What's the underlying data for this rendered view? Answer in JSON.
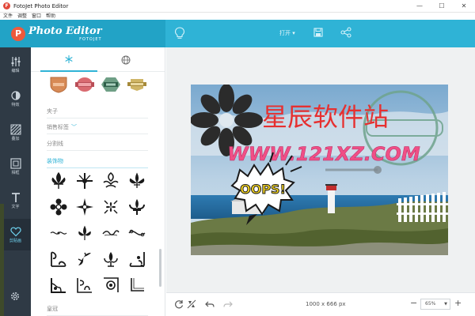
{
  "window": {
    "title": "FotoJet Photo Editor",
    "app_icon_letter": "F",
    "minimize": "—",
    "maximize": "☐",
    "close": "✕"
  },
  "menu": [
    "文件",
    "调整",
    "窗口",
    "帮助"
  ],
  "header": {
    "logo_letter": "P",
    "logo_title": "Photo Editor",
    "logo_sub": "FOTOJET",
    "open_label": "打开 ▾",
    "icons": [
      "bulb-icon",
      "save-icon",
      "share-icon"
    ]
  },
  "rail": {
    "items": [
      {
        "label": "编辑",
        "icon": "sliders-icon"
      },
      {
        "label": "特效",
        "icon": "effects-icon"
      },
      {
        "label": "叠加",
        "icon": "overlay-icon"
      },
      {
        "label": "相框",
        "icon": "frame-icon"
      },
      {
        "label": "文字",
        "icon": "text-icon"
      },
      {
        "label": "剪贴画",
        "icon": "heart-icon",
        "active": true
      }
    ],
    "settings_icon": "gear-icon"
  },
  "panel": {
    "tabs": [
      {
        "icon": "snowflake-icon",
        "active": true
      },
      {
        "icon": "globe-icon",
        "active": false
      }
    ],
    "sections": {
      "s1": "夹子",
      "s2": "销售标签",
      "s3": "分割线",
      "s4": "装饰物",
      "s5": "皇冠"
    }
  },
  "canvas": {
    "text_cn": "星辰软件站",
    "text_url": "WWW.121XZ.COM",
    "text_oops": "OOPS!"
  },
  "bottom": {
    "dimensions": "1000 x 666 px",
    "zoom": "65%",
    "zoom_minus": "−",
    "zoom_plus": "+"
  },
  "colors": {
    "header": "#2fb3d6",
    "rail": "#2f3a45",
    "accent": "#2fb3d6",
    "red_text": "#e63030",
    "pink_text": "#f04f86"
  }
}
